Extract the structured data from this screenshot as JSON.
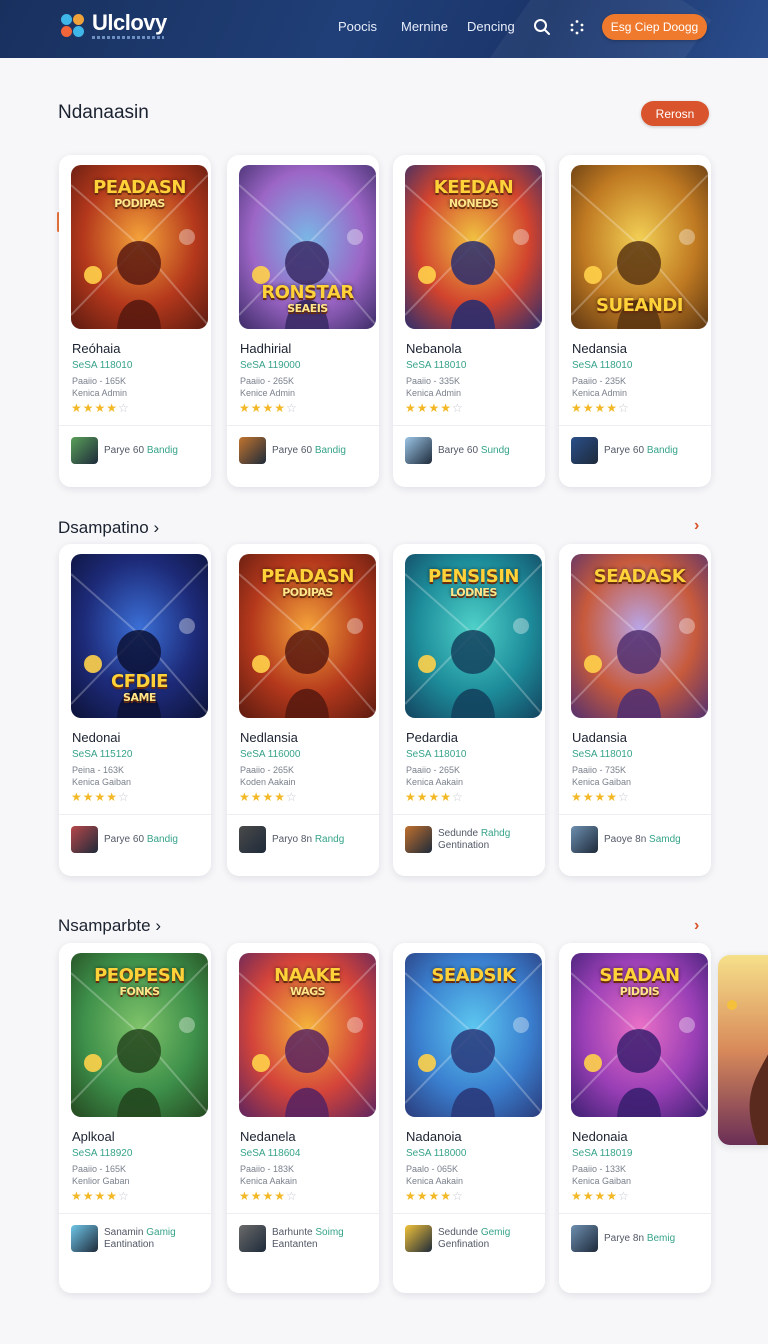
{
  "header": {
    "brand": "Ulclovy",
    "nav": [
      "Poocis",
      "Mernine",
      "Dencing"
    ],
    "cta": "Esg Ciep Doogg",
    "icons": [
      "search-icon",
      "apps-icon"
    ]
  },
  "sections": [
    {
      "title": "Ndanaasin",
      "action": "Rerosn",
      "cards": [
        {
          "name": "Reóhaia",
          "price": "SeSA 118010",
          "meta1": "Paaiio - 165K",
          "meta2": "Kenica Admin",
          "rating": 4,
          "foot": "Parye 60",
          "foot_tag": "Bandig",
          "banner": "PEADASN",
          "banner_sub": "PODIPAS",
          "palette": [
            "#f4a23a",
            "#b4381c",
            "#5a1a10"
          ]
        },
        {
          "name": "Hadhirial",
          "price": "SeSA 119000",
          "meta1": "Paaiio - 265K",
          "meta2": "Kenice Admin",
          "rating": 4,
          "foot": "Parye 60",
          "foot_tag": "Bandig",
          "banner": "RONSTAR",
          "banner_sub": "SEAEIS",
          "palette": [
            "#7ab6e6",
            "#9c66c6",
            "#3b2a66"
          ]
        },
        {
          "name": "Nebanola",
          "price": "SeSA 118010",
          "meta1": "Paaiio - 335K",
          "meta2": "Kenica Admin",
          "rating": 4,
          "foot": "Barye 60",
          "foot_tag": "Sundg",
          "banner": "KEEDAN",
          "banner_sub": "NONEDS",
          "palette": [
            "#f0c040",
            "#d1432e",
            "#2b2e6e"
          ]
        },
        {
          "name": "Nedansia",
          "price": "SeSA 118010",
          "meta1": "Paaiio - 235K",
          "meta2": "Kenica Admin",
          "rating": 4,
          "foot": "Parye 60",
          "foot_tag": "Bandig",
          "banner": "SUEANDI",
          "banner_sub": "",
          "palette": [
            "#f2cf55",
            "#c07a22",
            "#5c3612"
          ]
        }
      ]
    },
    {
      "title": "Dsampatino",
      "action": "›",
      "cards": [
        {
          "name": "Nedonai",
          "price": "SeSA 115120",
          "meta1": "Peina - 163K",
          "meta2": "Kenica Gaiban",
          "rating": 4,
          "foot": "Parye 60",
          "foot_tag": "Bandig",
          "banner": "CFDIE",
          "banner_sub": "SAME",
          "palette": [
            "#3b6fd6",
            "#1d2a78",
            "#0c1236"
          ]
        },
        {
          "name": "Nedlansia",
          "price": "SeSA 116000",
          "meta1": "Paaiio - 265K",
          "meta2": "Koden Aakain",
          "rating": 4,
          "foot": "Paryo 8n",
          "foot_tag": "Randg",
          "banner": "PEADASN",
          "banner_sub": "PODIPAS",
          "palette": [
            "#f4a23a",
            "#b4381c",
            "#5a1a10"
          ]
        },
        {
          "name": "Pedardia",
          "price": "SeSA 118010",
          "meta1": "Paaiio - 265K",
          "meta2": "Kenica Aakain",
          "rating": 4,
          "foot": "Sedunde",
          "foot_tag": "Rahdg",
          "foot2": "Gentination",
          "banner": "PENSISIN",
          "banner_sub": "LODNES",
          "palette": [
            "#4ed0c8",
            "#1d8c9a",
            "#13425e"
          ]
        },
        {
          "name": "Uadansia",
          "price": "SeSA 118010",
          "meta1": "Paaiio - 735K",
          "meta2": "Kenica Gaiban",
          "rating": 4,
          "foot": "Paoye 8n",
          "foot_tag": "Samdg",
          "banner": "SEADASK",
          "banner_sub": "",
          "palette": [
            "#b9a5e6",
            "#c75a3c",
            "#523070"
          ]
        }
      ]
    },
    {
      "title": "Nsamparbte",
      "action": "›",
      "cards": [
        {
          "name": "Aplkoal",
          "price": "SeSA 118920",
          "meta1": "Paaiio - 165K",
          "meta2": "Kenlior Gaban",
          "rating": 4,
          "foot": "Sanamin",
          "foot_tag": "Gamig",
          "foot2": "Eantination",
          "banner": "PEOPESN",
          "banner_sub": "FONKS",
          "palette": [
            "#7fc36a",
            "#3d8f4a",
            "#24471f"
          ]
        },
        {
          "name": "Nedanela",
          "price": "SeSA 118604",
          "meta1": "Paaiio - 183K",
          "meta2": "Kenica Aakain",
          "rating": 4,
          "foot": "Barhunte",
          "foot_tag": "Soimg",
          "foot2": "Eantanten",
          "banner": "NAAKE",
          "banner_sub": "WAGS",
          "palette": [
            "#f4b23a",
            "#d4443a",
            "#5a2460"
          ]
        },
        {
          "name": "Nadanoia",
          "price": "SeSA 118000",
          "meta1": "Paalo - 065K",
          "meta2": "Kenica Aakain",
          "rating": 4,
          "foot": "Sedunde",
          "foot_tag": "Gemig",
          "foot2": "Genfination",
          "banner": "SEADSIK",
          "banner_sub": "",
          "palette": [
            "#5cc6ef",
            "#3a7fcf",
            "#2a3a7a"
          ]
        },
        {
          "name": "Nedonaia",
          "price": "SeSA 118019",
          "meta1": "Paaiio - 133K",
          "meta2": "Kenica Gaiban",
          "rating": 4,
          "foot": "Parye 8n",
          "foot_tag": "Bemig",
          "banner": "SEADAN",
          "banner_sub": "PIDDIS",
          "palette": [
            "#e96fc6",
            "#9a3fb6",
            "#3b1f70"
          ]
        }
      ]
    }
  ],
  "colors": {
    "accent": "#ef7a2e",
    "action": "#d9532c",
    "price": "#36a38a",
    "star": "#f3b825",
    "header": "#1d3a70"
  }
}
